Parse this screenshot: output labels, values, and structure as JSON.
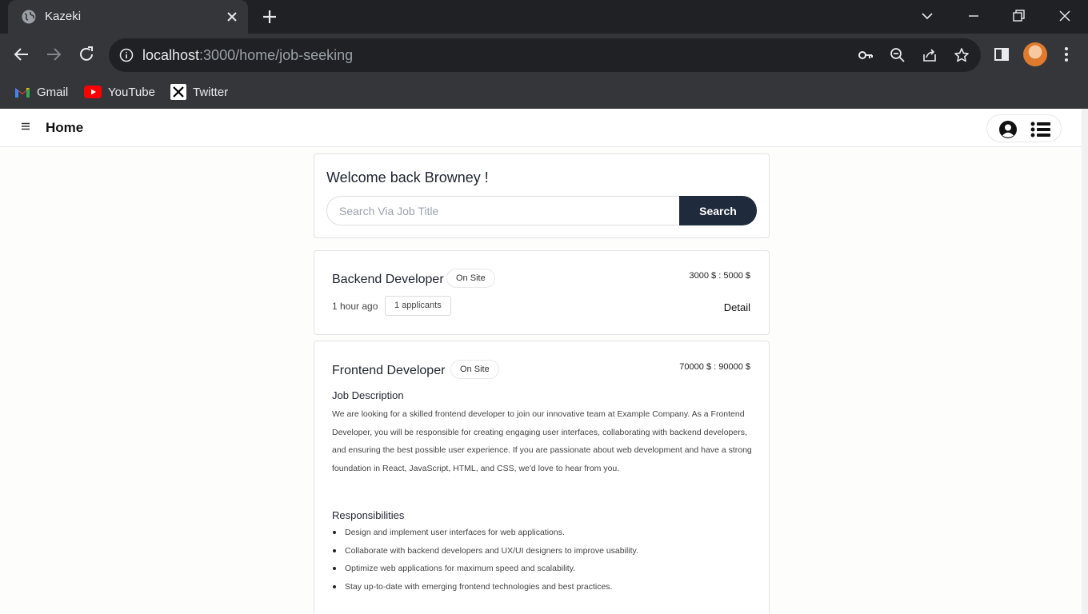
{
  "browser": {
    "tab_title": "Kazeki",
    "url_host": "localhost",
    "url_path": ":3000/home/job-seeking",
    "bookmarks": [
      {
        "label": "Gmail",
        "icon": "gmail-icon"
      },
      {
        "label": "YouTube",
        "icon": "youtube-icon"
      },
      {
        "label": "Twitter",
        "icon": "x-twitter-icon"
      }
    ]
  },
  "header": {
    "title": "Home"
  },
  "welcome": {
    "greeting": "Welcome back Browney !",
    "search_placeholder": "Search Via Job Title",
    "search_button": "Search"
  },
  "jobs": [
    {
      "title": "Backend Developer",
      "type": "On Site",
      "salary": "3000 $ : 5000 $",
      "posted": "1 hour ago",
      "applicants": "1 applicants",
      "detail_label": "Detail"
    },
    {
      "title": "Frontend Developer",
      "type": "On Site",
      "salary": "70000 $ : 90000 $",
      "description_heading": "Job Description",
      "description": "We are looking for a skilled frontend developer to join our innovative team at Example Company. As a Frontend Developer, you will be responsible for creating engaging user interfaces, collaborating with backend developers, and ensuring the best possible user experience. If you are passionate about web development and have a strong foundation in React, JavaScript, HTML, and CSS, we'd love to hear from you.",
      "responsibilities_heading": "Responsibilities",
      "responsibilities": [
        "Design and implement user interfaces for web applications.",
        "Collaborate with backend developers and UX/UI designers to improve usability.",
        "Optimize web applications for maximum speed and scalability.",
        "Stay up-to-date with emerging frontend technologies and best practices."
      ]
    }
  ],
  "colors": {
    "chrome_dark": "#202124",
    "chrome_toolbar": "#35363a",
    "search_button_bg": "#1f2a3c",
    "page_bg": "#fdfdfb"
  }
}
